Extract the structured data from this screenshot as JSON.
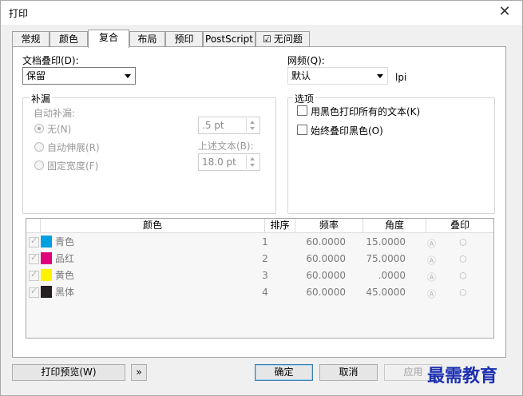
{
  "window": {
    "title": "打印"
  },
  "tabs": [
    {
      "label": "常规"
    },
    {
      "label": "颜色"
    },
    {
      "label": "复合"
    },
    {
      "label": "布局"
    },
    {
      "label": "预印"
    },
    {
      "label": "PostScript"
    },
    {
      "label": "无问题"
    }
  ],
  "active_tab": "复合",
  "doc_overprint": {
    "label": "文档叠印(D):",
    "value": "保留"
  },
  "screen_freq": {
    "label": "网频(Q):",
    "value": "默认",
    "unit": "lpi"
  },
  "trapping": {
    "title": "补漏",
    "auto_label": "自动补漏:",
    "options": [
      {
        "label": "无(N)",
        "selected": true
      },
      {
        "label": "自动伸展(R)",
        "selected": false
      },
      {
        "label": "固定宽度(F)",
        "selected": false
      }
    ],
    "width_value": ".5 pt",
    "above_text_label": "上述文本(B):",
    "above_text_value": "18.0 pt"
  },
  "options_group": {
    "title": "选项",
    "items": [
      {
        "label": "用黑色打印所有的文本(K)",
        "checked": false
      },
      {
        "label": "始终叠印黑色(O)",
        "checked": false
      }
    ]
  },
  "table": {
    "headers": [
      "颜色",
      "排序",
      "频率",
      "角度",
      "叠印"
    ],
    "rows": [
      {
        "name": "青色",
        "color": "#00a0e0",
        "order": "1",
        "freq": "60.0000",
        "angle": "15.0000"
      },
      {
        "name": "品红",
        "color": "#e0007a",
        "order": "2",
        "freq": "60.0000",
        "angle": "75.0000"
      },
      {
        "name": "黄色",
        "color": "#fff200",
        "order": "3",
        "freq": "60.0000",
        "angle": ".0000"
      },
      {
        "name": "黑体",
        "color": "#231f20",
        "order": "4",
        "freq": "60.0000",
        "angle": "45.0000"
      }
    ]
  },
  "buttons": {
    "preview": "打印预览(W)",
    "expand": "»",
    "ok": "确定",
    "cancel": "取消",
    "apply": "应用"
  },
  "watermark": "最需教育"
}
